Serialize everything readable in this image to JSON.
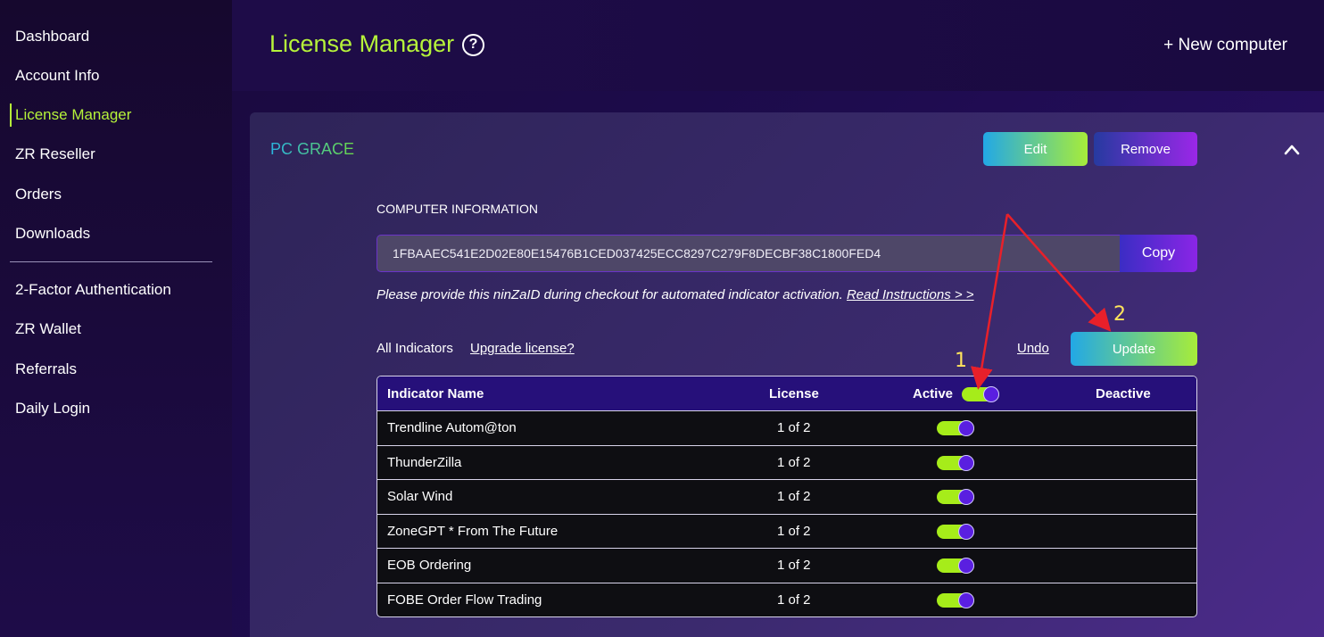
{
  "sidebar": {
    "items": [
      {
        "label": "Dashboard"
      },
      {
        "label": "Account Info"
      },
      {
        "label": "License Manager"
      },
      {
        "label": "ZR Reseller"
      },
      {
        "label": "Orders"
      },
      {
        "label": "Downloads"
      },
      {
        "label": "2-Factor Authentication"
      },
      {
        "label": "ZR Wallet"
      },
      {
        "label": "Referrals"
      },
      {
        "label": "Daily Login"
      }
    ],
    "active_index": 2
  },
  "header": {
    "title": "License Manager",
    "help_icon": "?",
    "new_computer": "+ New computer"
  },
  "panel": {
    "pc_name": "PC GRACE",
    "edit_label": "Edit",
    "remove_label": "Remove",
    "collapse_icon": "chevron-up-icon",
    "section_label": "COMPUTER INFORMATION",
    "ninzaid": "1FBAAEC541E2D02E80E15476B1CED037425ECC8297C279F8DECBF38C1800FED4",
    "copy_label": "Copy",
    "note": "Please provide this ninZaID during checkout for automated indicator activation. ",
    "note_link": "Read Instructions > >",
    "all_indicators": "All Indicators",
    "upgrade": "Upgrade license?",
    "undo": "Undo",
    "update": "Update"
  },
  "table": {
    "headers": {
      "name": "Indicator Name",
      "license": "License",
      "active": "Active",
      "deactive": "Deactive"
    },
    "header_toggle_on": true,
    "rows": [
      {
        "name": "Trendline Autom@ton",
        "license": "1 of 2",
        "active": true
      },
      {
        "name": "ThunderZilla",
        "license": "1 of 2",
        "active": true
      },
      {
        "name": "Solar Wind",
        "license": "1 of 2",
        "active": true
      },
      {
        "name": "ZoneGPT * From The Future",
        "license": "1 of 2",
        "active": true
      },
      {
        "name": "EOB Ordering",
        "license": "1 of 2",
        "active": true
      },
      {
        "name": "FOBE Order Flow Trading",
        "license": "1 of 2",
        "active": true
      }
    ]
  },
  "annotations": {
    "step1": "1",
    "step2": "2",
    "arrow_color": "#e8202a"
  },
  "colors": {
    "accent": "#b6f33a",
    "toggle_on": "#a6ec1a",
    "knob": "#5a1fe0"
  }
}
